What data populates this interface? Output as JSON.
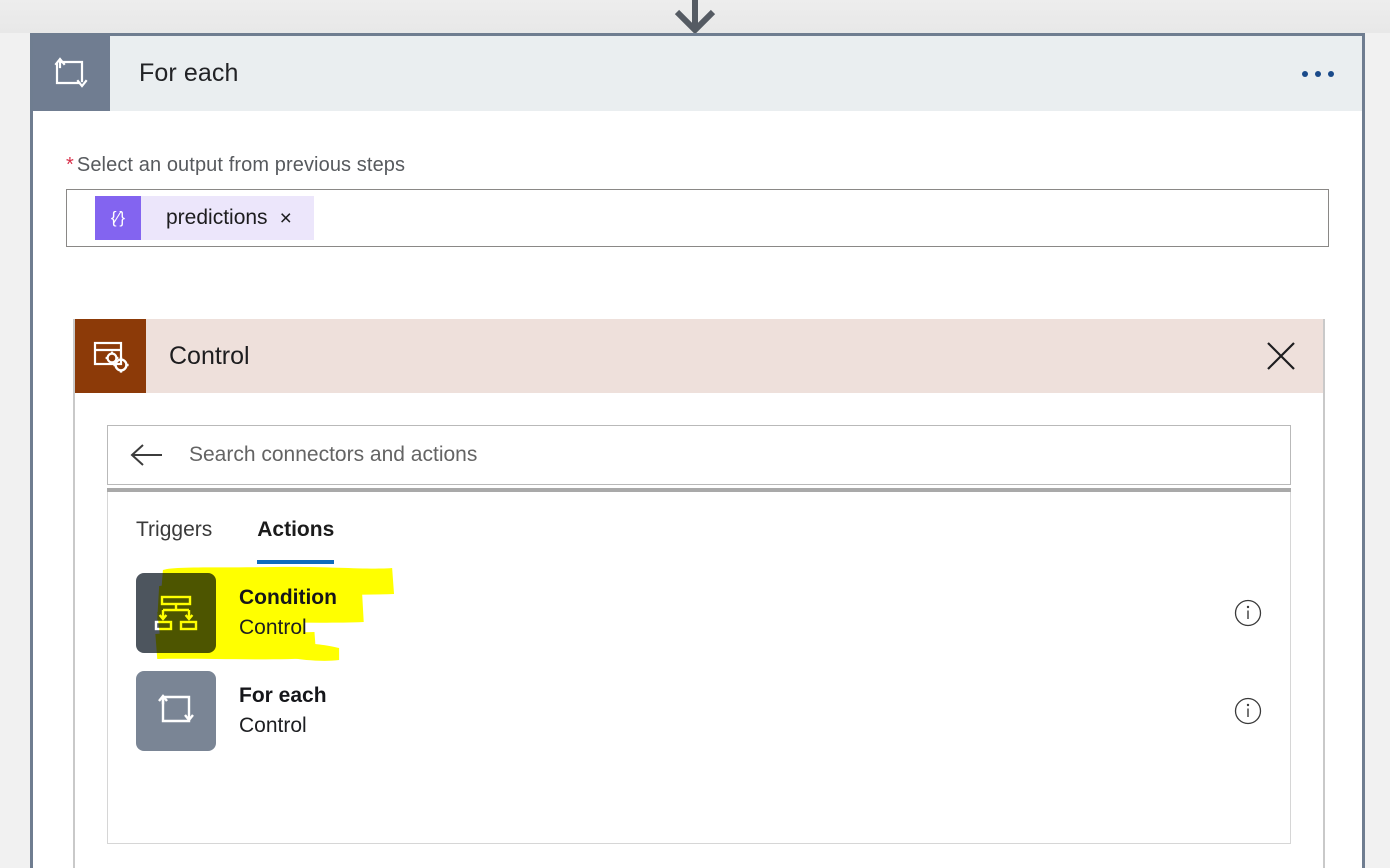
{
  "canvas": {
    "connector_arrow_icon": "arrow-down-icon",
    "background_color": "#f1f1f1"
  },
  "foreach_card": {
    "icon": "loop-icon",
    "title": "For each",
    "overflow_menu": {
      "icon": "ellipsis-icon",
      "label": "..."
    },
    "field": {
      "required_marker": "*",
      "label": "Select an output from previous steps",
      "token": {
        "icon": "expression-icon",
        "icon_glyph": "{∕}",
        "label": "predictions",
        "remove_icon": "close-icon",
        "remove_glyph": "×"
      }
    }
  },
  "control_panel": {
    "icon": "control-connector-icon",
    "title": "Control",
    "close_icon": "close-icon",
    "accent_color": "#8c3a08",
    "header_background": "#eee0db",
    "search": {
      "back_icon": "back-arrow-icon",
      "placeholder": "Search connectors and actions",
      "value": ""
    },
    "tabs": [
      {
        "label": "Triggers",
        "active": false
      },
      {
        "label": "Actions",
        "active": true
      }
    ],
    "tab_accent_color": "#0f6cbd",
    "actions": [
      {
        "icon": "condition-icon",
        "icon_color": "#4d555e",
        "name": "Condition",
        "connector": "Control",
        "info_icon": "info-icon",
        "highlighted": true
      },
      {
        "icon": "loop-icon",
        "icon_color": "#7a8595",
        "name": "For each",
        "connector": "Control",
        "info_icon": "info-icon",
        "highlighted": false
      }
    ],
    "annotation": {
      "type": "highlighter-marker",
      "color": "#ffff00",
      "target": "Condition"
    }
  }
}
